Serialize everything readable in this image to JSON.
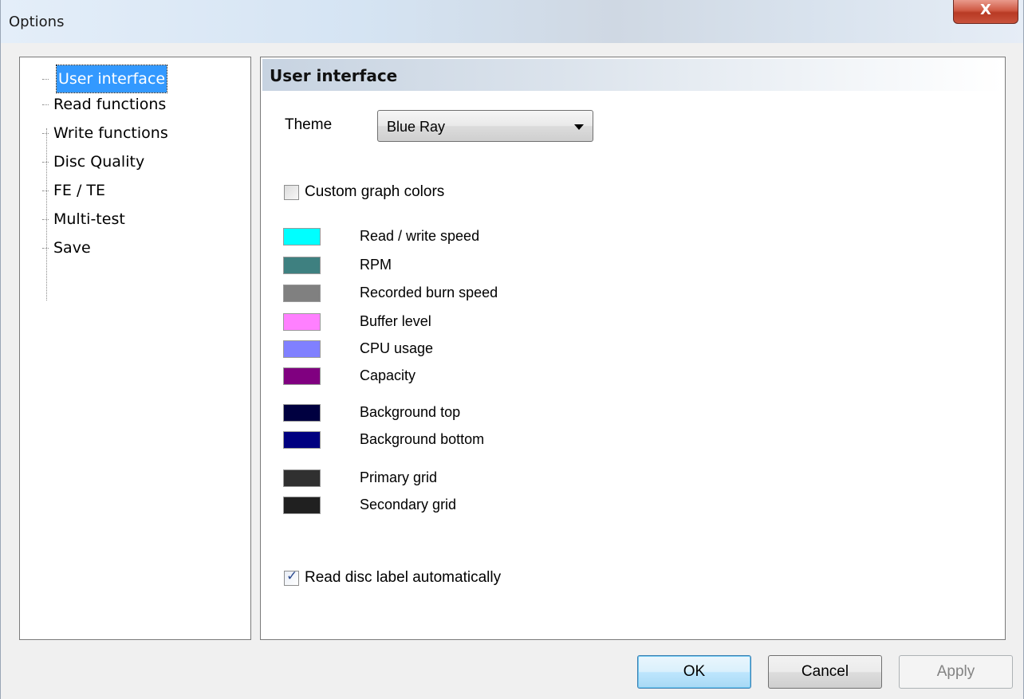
{
  "window": {
    "title": "Options",
    "close_glyph": "X"
  },
  "tree": {
    "items": [
      {
        "label": "User interface",
        "selected": true
      },
      {
        "label": "Read functions"
      },
      {
        "label": "Write functions"
      },
      {
        "label": "Disc Quality"
      },
      {
        "label": "FE / TE"
      },
      {
        "label": "Multi-test"
      },
      {
        "label": "Save"
      }
    ]
  },
  "main": {
    "section_title": "User interface",
    "theme": {
      "label": "Theme",
      "value": "Blue Ray"
    },
    "custom_colors": {
      "label": "Custom graph colors",
      "checked": false
    },
    "colors": [
      {
        "label": "Read / write speed",
        "color": "#00ffff"
      },
      {
        "label": "RPM",
        "color": "#3e8080"
      },
      {
        "label": "Recorded burn speed",
        "color": "#808080"
      },
      {
        "label": "Buffer level",
        "color": "#ff80ff"
      },
      {
        "label": "CPU usage",
        "color": "#8080ff"
      },
      {
        "label": "Capacity",
        "color": "#800080"
      },
      {
        "label": "Background top",
        "color": "#000040"
      },
      {
        "label": "Background bottom",
        "color": "#000080"
      },
      {
        "label": "Primary grid",
        "color": "#303030"
      },
      {
        "label": "Secondary grid",
        "color": "#202020"
      }
    ],
    "read_label": {
      "label": "Read disc label automatically",
      "checked": true
    }
  },
  "buttons": {
    "ok": "OK",
    "cancel": "Cancel",
    "apply": "Apply"
  }
}
